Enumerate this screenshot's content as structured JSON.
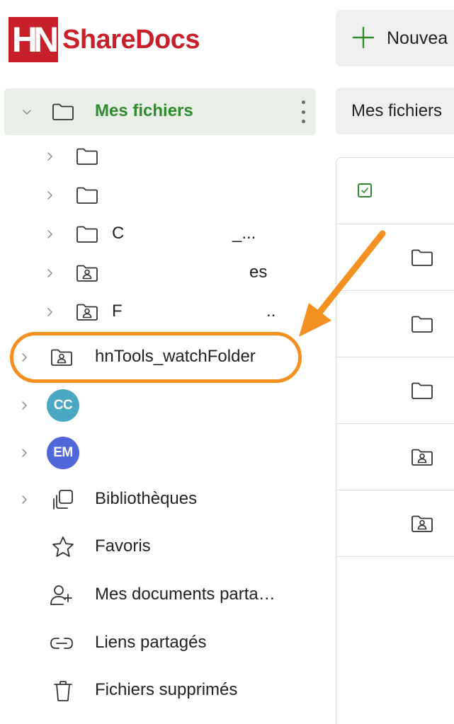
{
  "app": {
    "logo_mark": "HN",
    "name": "ShareDocs"
  },
  "toolbar": {
    "new_label": "Nouvea"
  },
  "breadcrumb": {
    "label": "Mes fichiers"
  },
  "sidebar": {
    "root": {
      "label": "Mes fichiers",
      "icon": "folder-icon"
    },
    "children": [
      {
        "label": "",
        "icon": "folder-icon"
      },
      {
        "label": "",
        "icon": "folder-icon"
      },
      {
        "label": "C",
        "trail": "_...",
        "icon": "folder-icon"
      },
      {
        "label": "",
        "trail": "es",
        "icon": "shared-folder-icon"
      },
      {
        "label": "F",
        "trail": "..",
        "icon": "shared-folder-icon"
      }
    ],
    "watch_folder": {
      "label": "hnTools_watchFolder",
      "icon": "shared-folder-icon"
    },
    "users": [
      {
        "initials": "CC",
        "color": "#4aa8c2"
      },
      {
        "initials": "EM",
        "color": "#4f67d8"
      }
    ],
    "sections": [
      {
        "label": "Bibliothèques",
        "icon": "libraries-icon",
        "expandable": true
      },
      {
        "label": "Favoris",
        "icon": "star-icon",
        "expandable": false
      },
      {
        "label": "Mes documents parta…",
        "icon": "share-user-icon",
        "expandable": false
      },
      {
        "label": "Liens partagés",
        "icon": "link-icon",
        "expandable": false
      },
      {
        "label": "Fichiers supprimés",
        "icon": "trash-icon",
        "expandable": false
      }
    ]
  },
  "file_list": {
    "rows": [
      {
        "icon": "folder-icon"
      },
      {
        "icon": "folder-icon"
      },
      {
        "icon": "folder-icon"
      },
      {
        "icon": "shared-folder-icon"
      },
      {
        "icon": "shared-folder-icon"
      }
    ]
  },
  "colors": {
    "brand": "#c8202a",
    "accent_green": "#2e8b2e",
    "annotation": "#f39020",
    "selected_bg": "#e8efe6"
  }
}
